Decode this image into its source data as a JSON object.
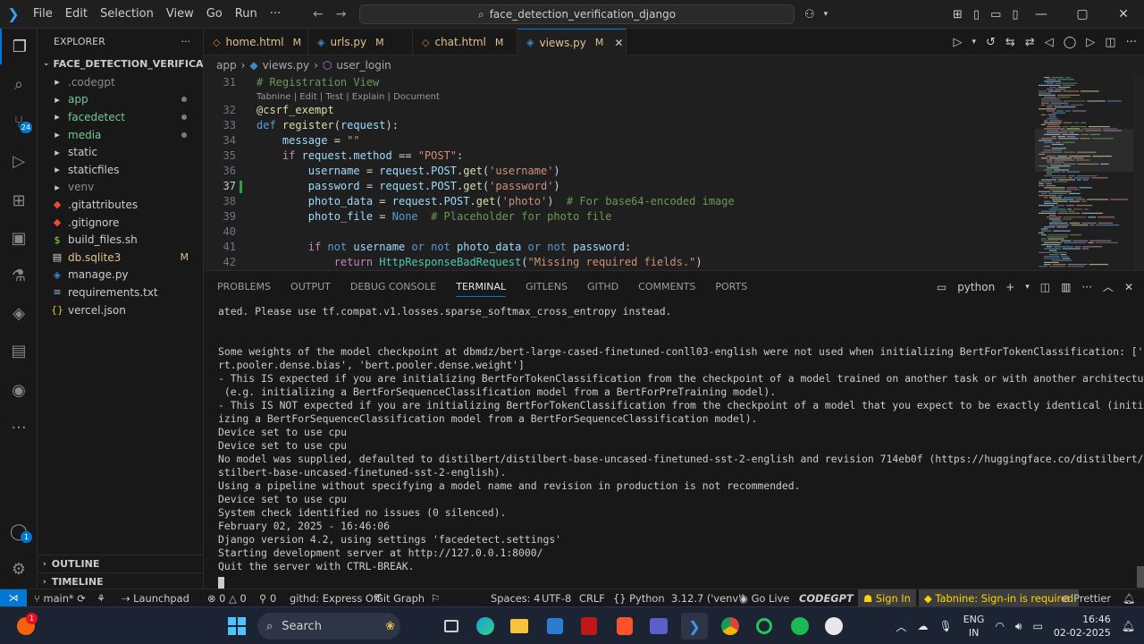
{
  "titlebar": {
    "menu": [
      "File",
      "Edit",
      "Selection",
      "View",
      "Go",
      "Run",
      "···"
    ],
    "search": "face_detection_verification_django"
  },
  "activitybar": {
    "scm_badge": "24",
    "account_badge": "1"
  },
  "sidebar": {
    "header": "EXPLORER",
    "more": "···",
    "project": "FACE_DETECTION_VERIFICATION_...",
    "items": [
      {
        "label": "codegpt",
        "prefix": ".",
        "type": "folder",
        "color": "#8c8c8c",
        "mark": ""
      },
      {
        "label": "app",
        "prefix": "",
        "type": "folder",
        "color": "#73c991",
        "mark": "dot"
      },
      {
        "label": "facedetect",
        "prefix": "",
        "type": "folder",
        "color": "#73c991",
        "mark": "dot"
      },
      {
        "label": "media",
        "prefix": "",
        "type": "folder",
        "color": "#73c991",
        "mark": "dot"
      },
      {
        "label": "static",
        "prefix": "",
        "type": "folder",
        "color": "#cccccc",
        "mark": ""
      },
      {
        "label": "staticfiles",
        "prefix": "",
        "type": "folder",
        "color": "#cccccc",
        "mark": ""
      },
      {
        "label": "venv",
        "prefix": "",
        "type": "folder",
        "color": "#8c8c8c",
        "mark": ""
      },
      {
        "label": "gitattributes",
        "prefix": ".",
        "type": "git",
        "color": "#cccccc",
        "mark": ""
      },
      {
        "label": "gitignore",
        "prefix": ".",
        "type": "git",
        "color": "#cccccc",
        "mark": ""
      },
      {
        "label": "build_files.sh",
        "prefix": "",
        "type": "shell",
        "color": "#cccccc",
        "mark": ""
      },
      {
        "label": "db.sqlite3",
        "prefix": "",
        "type": "db",
        "color": "#e2c08d",
        "mark": "M"
      },
      {
        "label": "manage.py",
        "prefix": "",
        "type": "python",
        "color": "#cccccc",
        "mark": ""
      },
      {
        "label": "requirements.txt",
        "prefix": "",
        "type": "text",
        "color": "#cccccc",
        "mark": ""
      },
      {
        "label": "vercel.json",
        "prefix": "",
        "type": "json",
        "color": "#cccccc",
        "mark": ""
      }
    ],
    "outline": "OUTLINE",
    "timeline": "TIMELINE"
  },
  "tabs": [
    {
      "label": "home.html",
      "mod": "M",
      "icon": "html-icon",
      "active": false
    },
    {
      "label": "urls.py",
      "mod": "M",
      "icon": "python-icon",
      "active": false
    },
    {
      "label": "chat.html",
      "mod": "M",
      "icon": "html-icon",
      "active": false
    },
    {
      "label": "views.py",
      "mod": "M",
      "icon": "python-icon",
      "active": true
    }
  ],
  "breadcrumb": [
    "app",
    "views.py",
    "user_login"
  ],
  "editor": {
    "codelens": "Tabnine | Edit | Test | Explain | Document",
    "lines": [
      {
        "n": "31",
        "html": "<span class='cm'># Registration View</span>"
      },
      {
        "n": "32",
        "html": "<span class='dec'>@csrf_exempt</span>"
      },
      {
        "n": "33",
        "html": "<span class='kw'>def</span> <span class='fn'>register</span><span class='op'>(</span><span class='var'>request</span><span class='op'>):</span>"
      },
      {
        "n": "34",
        "html": "    <span class='var'>message</span> <span class='op'>=</span> <span class='str'>\"\"</span>"
      },
      {
        "n": "35",
        "html": "    <span class='kw2'>if</span> <span class='var'>request</span><span class='op'>.</span><span class='var'>method</span> <span class='op'>==</span> <span class='str'>\"POST\"</span><span class='op'>:</span>"
      },
      {
        "n": "36",
        "html": "        <span class='var'>username</span> <span class='op'>=</span> <span class='var'>request</span><span class='op'>.</span><span class='var'>POST</span><span class='op'>.</span><span class='fn'>get</span><span class='op'>(</span><span class='str'>'username'</span><span class='op'>)</span>"
      },
      {
        "n": "37",
        "html": "        <span class='var'>password</span> <span class='op'>=</span> <span class='var'>request</span><span class='op'>.</span><span class='var'>POST</span><span class='op'>.</span><span class='fn'>get</span><span class='op'>(</span><span class='str'>'password'</span><span class='op'>)</span>"
      },
      {
        "n": "38",
        "html": "        <span class='var'>photo_data</span> <span class='op'>=</span> <span class='var'>request</span><span class='op'>.</span><span class='var'>POST</span><span class='op'>.</span><span class='fn'>get</span><span class='op'>(</span><span class='str'>'photo'</span><span class='op'>)</span>  <span class='cm'># For base64-encoded image</span>"
      },
      {
        "n": "39",
        "html": "        <span class='var'>photo_file</span> <span class='op'>=</span> <span class='kw'>None</span>  <span class='cm'># Placeholder for photo file</span>"
      },
      {
        "n": "40",
        "html": ""
      },
      {
        "n": "41",
        "html": "        <span class='kw2'>if</span> <span class='kw'>not</span> <span class='var'>username</span> <span class='kw'>or</span> <span class='kw'>not</span> <span class='var'>photo_data</span> <span class='kw'>or</span> <span class='kw'>not</span> <span class='var'>password</span><span class='op'>:</span>"
      },
      {
        "n": "42",
        "html": "            <span class='kw2'>return</span> <span class='cls'>HttpResponseBadRequest</span><span class='op'>(</span><span class='str'>\"Missing required fields.\"</span><span class='op'>)</span>"
      }
    ]
  },
  "panel": {
    "tabs": [
      "PROBLEMS",
      "OUTPUT",
      "DEBUG CONSOLE",
      "TERMINAL",
      "GITLENS",
      "GITHD",
      "COMMENTS",
      "PORTS"
    ],
    "active_tab": "TERMINAL",
    "shell": "python",
    "terminal_lines": [
      "ated. Please use tf.compat.v1.losses.sparse_softmax_cross_entropy instead.",
      "",
      "Some weights of the model checkpoint at dbmdz/bert-large-cased-finetuned-conll03-english were not used when initializing BertForTokenClassification: ['be",
      "rt.pooler.dense.bias', 'bert.pooler.dense.weight']",
      "- This IS expected if you are initializing BertForTokenClassification from the checkpoint of a model trained on another task or with another architecture",
      " (e.g. initializing a BertForSequenceClassification model from a BertForPreTraining model).",
      "- This IS NOT expected if you are initializing BertForTokenClassification from the checkpoint of a model that you expect to be exactly identical (initial",
      "izing a BertForSequenceClassification model from a BertForSequenceClassification model).",
      "Device set to use cpu",
      "Device set to use cpu",
      "No model was supplied, defaulted to distilbert/distilbert-base-uncased-finetuned-sst-2-english and revision 714eb0f (https://huggingface.co/distilbert/di",
      "stilbert-base-uncased-finetuned-sst-2-english).",
      "Using a pipeline without specifying a model name and revision in production is not recommended.",
      "Device set to use cpu",
      "System check identified no issues (0 silenced).",
      "February 02, 2025 - 16:46:06",
      "Django version 4.2, using settings 'facedetect.settings'",
      "Starting development server at http://127.0.0.1:8000/",
      "Quit the server with CTRL-BREAK."
    ]
  },
  "statusbar": {
    "branch": "main*",
    "errors": "0",
    "warnings": "0",
    "ports": "0",
    "githd": "githd: Express Off",
    "git_graph": "Git Graph",
    "launchpad": "Launchpad",
    "spaces": "Spaces: 4",
    "encoding": "UTF-8",
    "eol": "CRLF",
    "language": "Python",
    "interpreter": "3.12.7 ('venv')",
    "golive": "Go Live",
    "codegpt": "CODEGPT",
    "signin": "Sign In",
    "tabnine": "Tabnine: Sign-in is required",
    "prettier": "Prettier"
  },
  "taskbar": {
    "search": "Search",
    "lang_top": "ENG",
    "lang_bottom": "IN",
    "time": "16:46",
    "date": "02-02-2025",
    "notification_badge": "1"
  }
}
